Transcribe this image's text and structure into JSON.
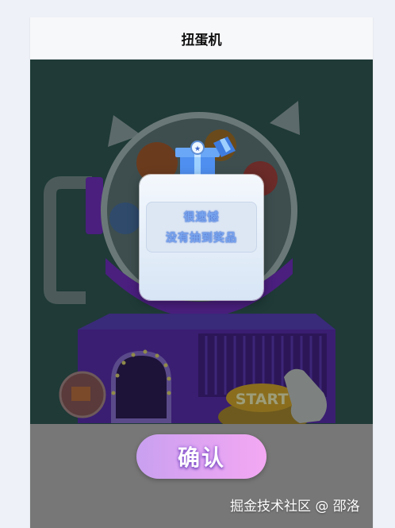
{
  "navbar": {
    "title": "扭蛋机"
  },
  "machine": {
    "start_label": "START"
  },
  "popup": {
    "line1": "很遗憾",
    "line2": "没有抽到奖品"
  },
  "confirm": {
    "label": "确认"
  },
  "watermark": {
    "text": "掘金技术社区 @ 邵洛"
  },
  "colors": {
    "stage_bg": "#1f3a37",
    "floor_bg": "#777777",
    "button_gradient_start": "#c9a0f0",
    "button_gradient_end": "#f4a8f3",
    "machine_purple": "#5a2a9a"
  }
}
